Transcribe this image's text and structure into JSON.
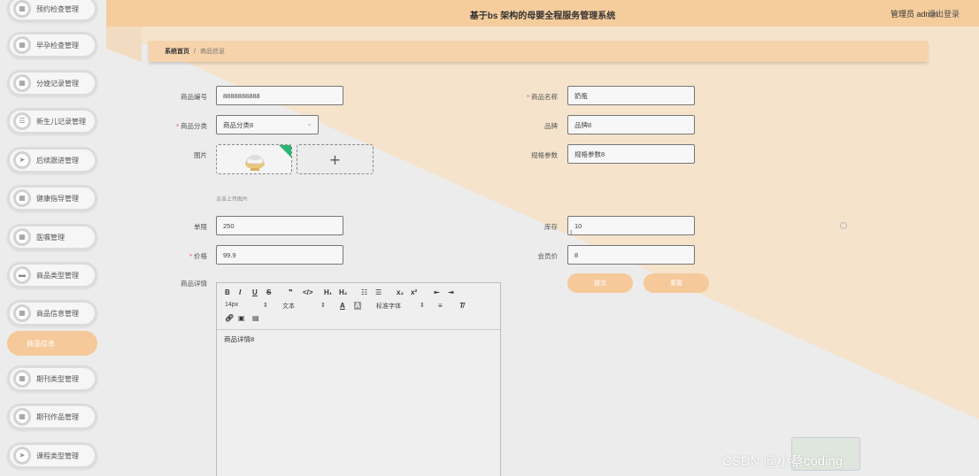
{
  "sidebar": {
    "items": [
      {
        "label": "预约检查管理",
        "icon": "grid-icon"
      },
      {
        "label": "早孕检查管理",
        "icon": "grid-icon"
      },
      {
        "label": "分娩记录管理",
        "icon": "grid-icon"
      },
      {
        "label": "新生儿记录管理",
        "icon": "list-icon"
      },
      {
        "label": "后续跟进管理",
        "icon": "send-icon"
      },
      {
        "label": "健康指导管理",
        "icon": "grid-icon"
      },
      {
        "label": "医嘱管理",
        "icon": "grid-icon"
      },
      {
        "label": "商品类型管理",
        "icon": "card-icon"
      },
      {
        "label": "商品信息管理",
        "icon": "grid-icon"
      },
      {
        "label": "商品信息",
        "icon": ""
      },
      {
        "label": "期刊类型管理",
        "icon": "grid-icon"
      },
      {
        "label": "期刊作品管理",
        "icon": "grid-icon"
      },
      {
        "label": "课程类型管理",
        "icon": "send-icon"
      }
    ]
  },
  "header": {
    "title": "基于bs 架构的母婴全程服务管理系统",
    "admin": "管理员 admin",
    "logout": "退出登录"
  },
  "breadcrumb": {
    "home": "系统首页",
    "sep": "/",
    "current": "商品信息"
  },
  "form": {
    "code_label": "商品编号",
    "code_value": "8888888888",
    "name_label": "商品名称",
    "name_value": "奶瓶",
    "category_label": "商品分类",
    "category_value": "商品分类8",
    "brand_label": "品牌",
    "brand_value": "品牌8",
    "image_label": "图片",
    "spec_label": "规格参数",
    "spec_value": "规格参数8",
    "upload_hint": "点击上传图片",
    "unit_price_label": "单限",
    "unit_price_value": "250",
    "stock_label": "库存",
    "stock_value": "10",
    "price_label": "价格",
    "price_value": "99.9",
    "member_price_label": "会员价",
    "member_price_value": "8",
    "detail_label": "商品详情",
    "submit": "提交",
    "reset": "重置"
  },
  "editor": {
    "font_size": "14px",
    "text_type": "文本",
    "font_family": "标准字体",
    "content": "商品详情8"
  },
  "watermark": "CSDN @小蔡coding",
  "colors": {
    "accent": "#f5c99a",
    "header": "#f5cc9c",
    "breadcrumb": "#f6d3ab"
  }
}
